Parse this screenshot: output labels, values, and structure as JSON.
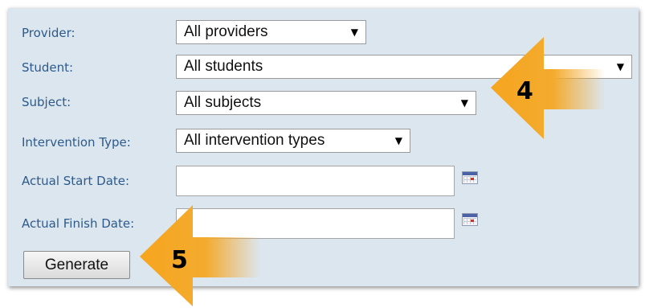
{
  "form": {
    "provider": {
      "label": "Provider:",
      "value": "All providers"
    },
    "student": {
      "label": "Student:",
      "value": "All students"
    },
    "subject": {
      "label": "Subject:",
      "value": "All subjects"
    },
    "intervention_type": {
      "label": "Intervention Type:",
      "value": "All intervention types"
    },
    "actual_start_date": {
      "label": "Actual Start Date:",
      "value": ""
    },
    "actual_finish_date": {
      "label": "Actual Finish Date:",
      "value": ""
    },
    "generate_label": "Generate"
  },
  "callouts": {
    "step4": "4",
    "step5": "5"
  },
  "colors": {
    "panel_bg": "#dce6ef",
    "label_text": "#2d5a8a",
    "arrow_orange": "#f5a623",
    "arrow_fade": "#9bab6a"
  },
  "icons": {
    "dropdown": "triangle-down",
    "date_picker": "calendar"
  }
}
